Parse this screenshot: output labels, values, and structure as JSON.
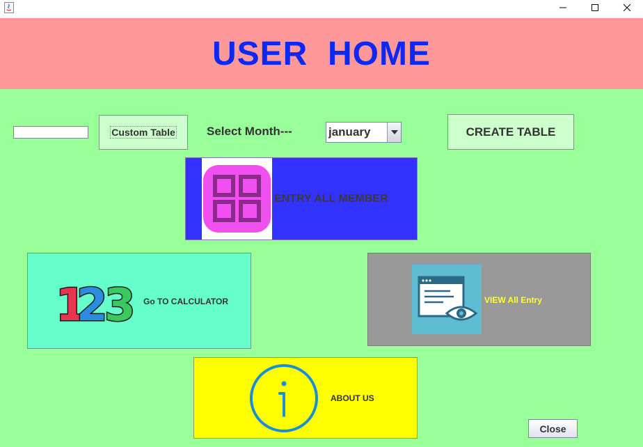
{
  "header": {
    "title": "USER  HOME"
  },
  "controls": {
    "custom_table_input": "",
    "custom_table_label": "Custom Table",
    "select_month_label": "Select Month---",
    "month_selected": "january",
    "create_table_label": "CREATE TABLE"
  },
  "tiles": {
    "entry": {
      "label": "ENTRY ALL MEMBER",
      "icon": "grid-icon"
    },
    "calculator": {
      "label": "Go TO CALCULATOR",
      "icon": "numbers-123-icon"
    },
    "view": {
      "label": "VIEW All Entry",
      "icon": "view-window-icon"
    },
    "about": {
      "label": "ABOUT US",
      "icon": "info-icon"
    }
  },
  "footer": {
    "close_label": "Close"
  },
  "colors": {
    "background": "#99ff99",
    "header": "#ff9999",
    "title": "#0d28f2",
    "entry_tile": "#3333ff",
    "calc_tile": "#66ffcc",
    "view_tile": "#999999",
    "about_tile": "#ffff00"
  }
}
